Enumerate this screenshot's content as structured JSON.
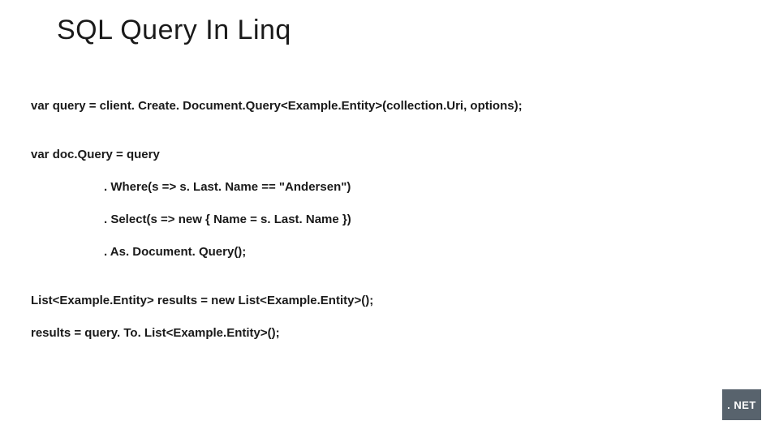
{
  "title": "SQL Query In Linq",
  "code": {
    "line1": "var query = client. Create. Document.Query<Example.Entity>(collection.Uri, options);",
    "line2": "var doc.Query = query",
    "line3": ". Where(s => s. Last. Name == \"Andersen\")",
    "line4": ". Select(s => new { Name = s. Last. Name })",
    "line5": ". As. Document. Query();",
    "line6": "List<Example.Entity> results = new List<Example.Entity>();",
    "line7": "results = query. To. List<Example.Entity>();"
  },
  "badge": ". NET"
}
